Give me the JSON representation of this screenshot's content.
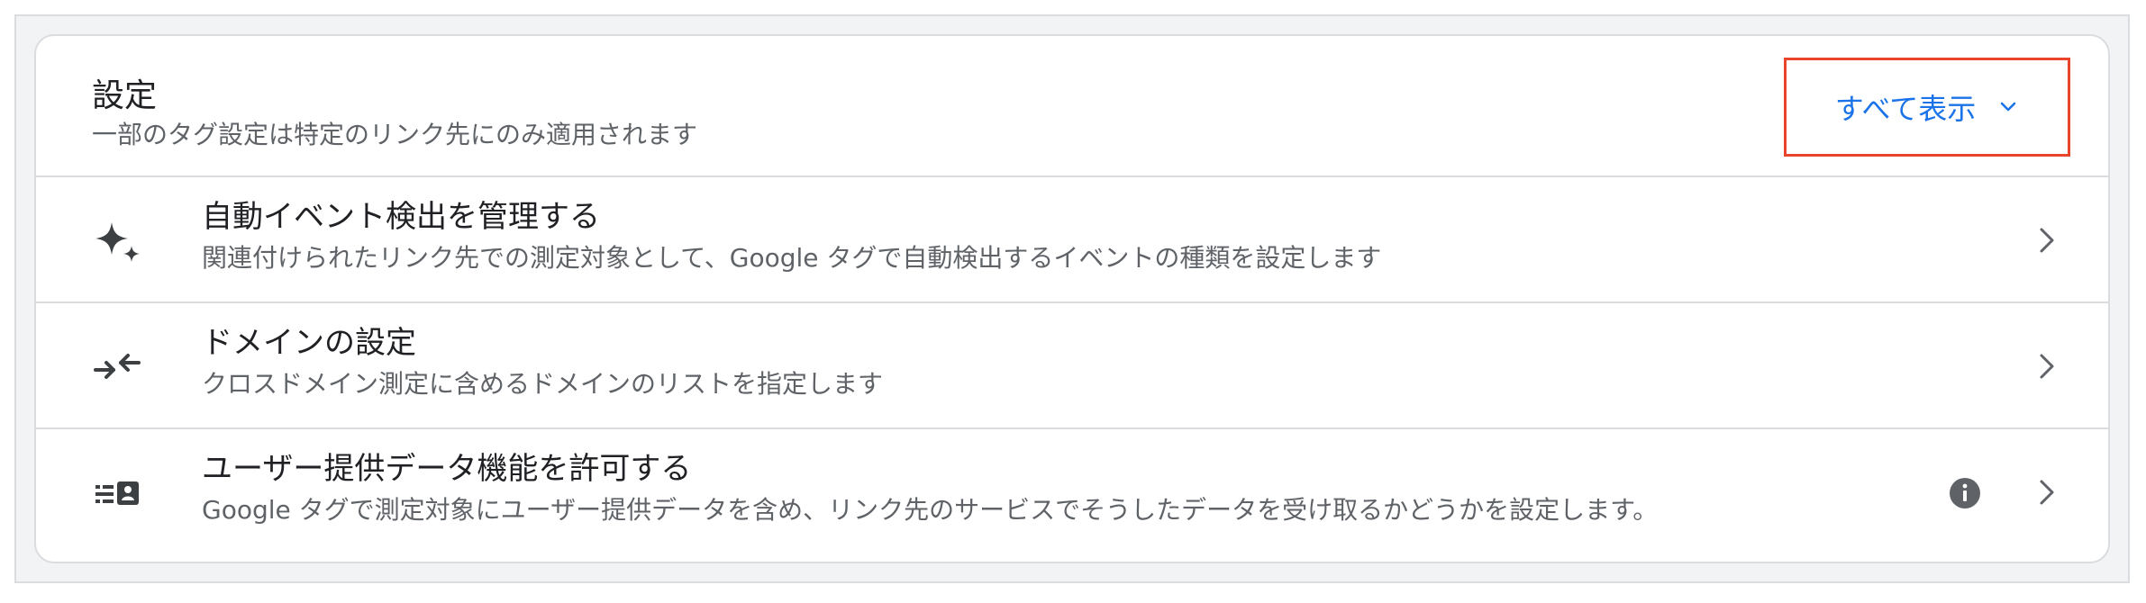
{
  "header": {
    "title": "設定",
    "subtitle": "一部のタグ設定は特定のリンク先にのみ適用されます",
    "show_all_label": "すべて表示"
  },
  "rows": [
    {
      "icon": "sparkle-icon",
      "title": "自動イベント検出を管理する",
      "subtitle": "関連付けられたリンク先での測定対象として、Google タグで自動検出するイベントの種類を設定します"
    },
    {
      "icon": "arrows-inward-icon",
      "title": "ドメインの設定",
      "subtitle": "クロスドメイン測定に含めるドメインのリストを指定します"
    },
    {
      "icon": "user-data-icon",
      "title": "ユーザー提供データ機能を許可する",
      "subtitle": "Google タグで測定対象にユーザー提供データを含め、リンク先のサービスでそうしたデータを受け取るかどうかを設定します。",
      "has_info": true
    }
  ],
  "colors": {
    "accent": "#1a73e8",
    "highlight_border": "#e8452c",
    "text_primary": "#202124",
    "text_secondary": "#5f6368",
    "icon": "#3c4043",
    "divider": "#dadce0"
  }
}
